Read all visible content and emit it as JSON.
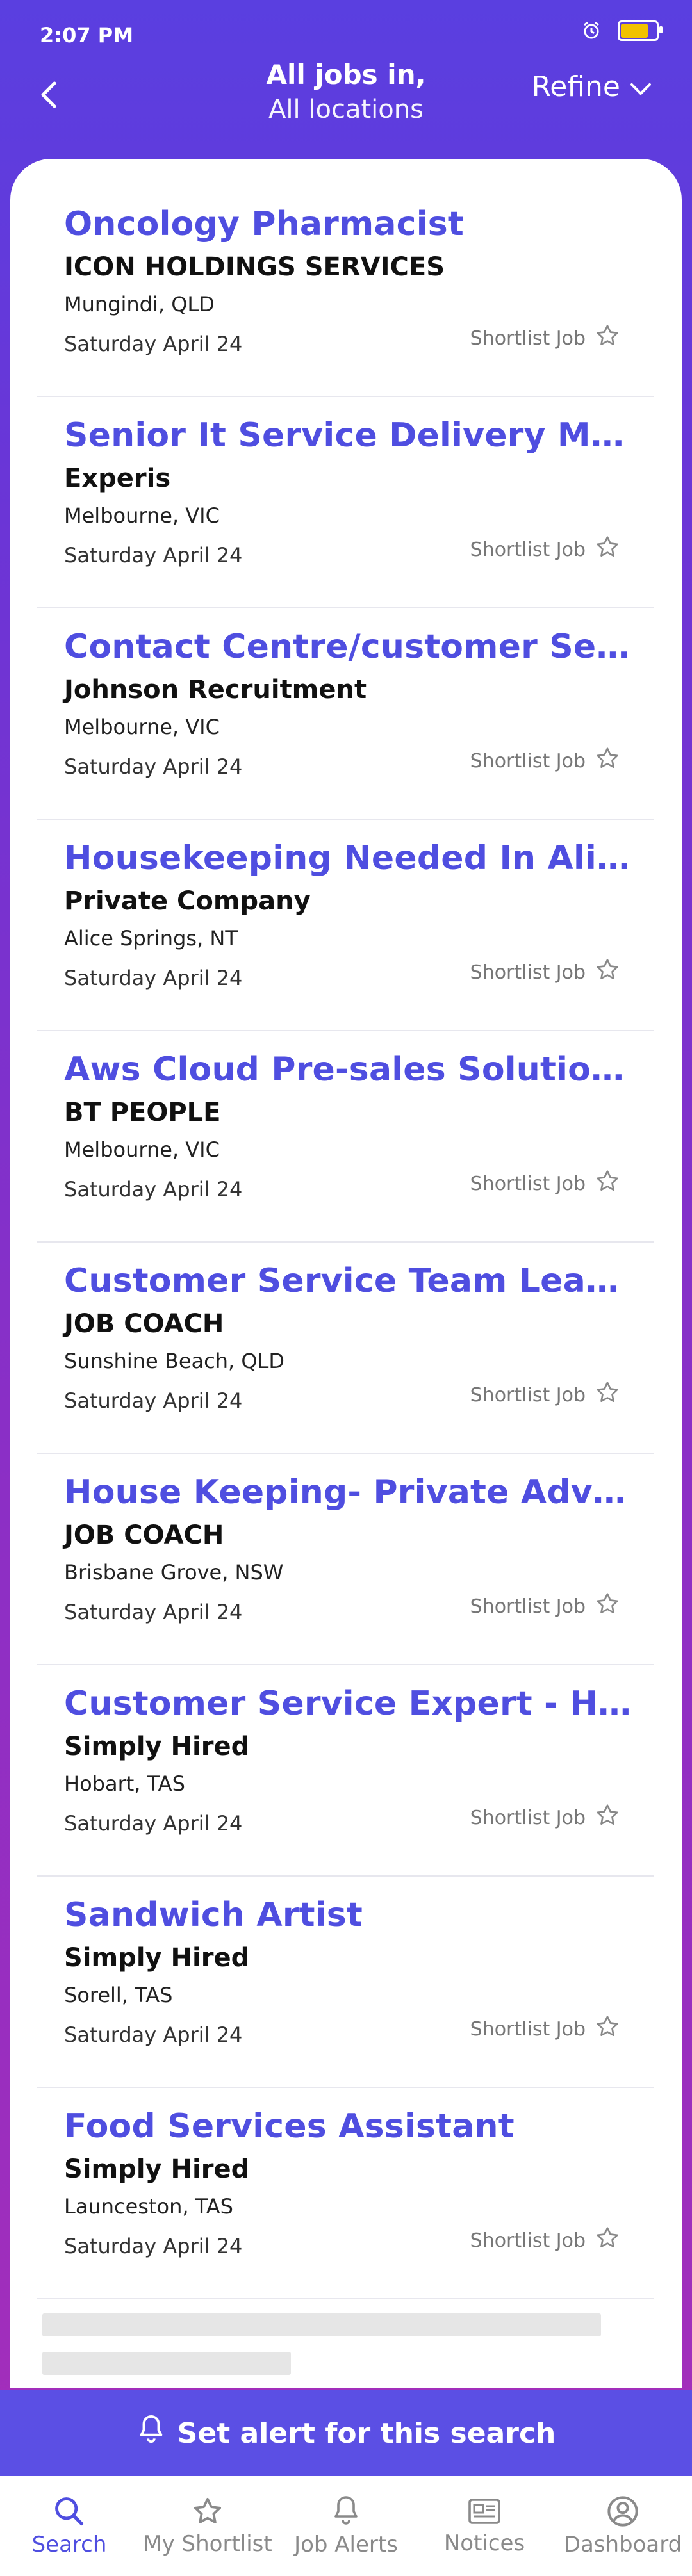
{
  "status_bar": {
    "time": "2:07 PM",
    "battery_level_percent": 80
  },
  "header": {
    "title_line1": "All jobs in,",
    "title_line2": "All locations",
    "refine_label": "Refine"
  },
  "jobs": [
    {
      "title": "Oncology Pharmacist",
      "company": "ICON HOLDINGS SERVICES",
      "location": "Mungindi, QLD",
      "date": "Saturday April 24",
      "shortlist_label": "Shortlist Job"
    },
    {
      "title": "Senior It Service Delivery Manager",
      "company": "Experis",
      "location": "Melbourne, VIC",
      "date": "Saturday April 24",
      "shortlist_label": "Shortlist Job"
    },
    {
      "title": "Contact Centre/customer Service",
      "company": "Johnson Recruitment",
      "location": "Melbourne, VIC",
      "date": "Saturday April 24",
      "shortlist_label": "Shortlist Job"
    },
    {
      "title": "Housekeeping Needed In Alice Springs",
      "company": "Private Company",
      "location": "Alice Springs, NT",
      "date": "Saturday April 24",
      "shortlist_label": "Shortlist Job"
    },
    {
      "title": "Aws Cloud Pre-sales Solutions Architect",
      "company": "BT PEOPLE",
      "location": "Melbourne, VIC",
      "date": "Saturday April 24",
      "shortlist_label": "Shortlist Job"
    },
    {
      "title": "Customer Service Team Leader",
      "company": "JOB COACH",
      "location": "Sunshine Beach, QLD",
      "date": "Saturday April 24",
      "shortlist_label": "Shortlist Job"
    },
    {
      "title": "House Keeping- Private Advertiser",
      "company": "JOB COACH",
      "location": "Brisbane Grove, NSW",
      "date": "Saturday April 24",
      "shortlist_label": "Shortlist Job"
    },
    {
      "title": "Customer Service Expert - Hobart",
      "company": "Simply Hired",
      "location": "Hobart, TAS",
      "date": "Saturday April 24",
      "shortlist_label": "Shortlist Job"
    },
    {
      "title": "Sandwich Artist",
      "company": "Simply Hired",
      "location": "Sorell, TAS",
      "date": "Saturday April 24",
      "shortlist_label": "Shortlist Job"
    },
    {
      "title": "Food Services Assistant",
      "company": "Simply Hired",
      "location": "Launceston, TAS",
      "date": "Saturday April 24",
      "shortlist_label": "Shortlist Job"
    }
  ],
  "alert": {
    "label": "Set alert for this search"
  },
  "nav": {
    "search": "Search",
    "shortlist": "My Shortlist",
    "job_alerts": "Job Alerts",
    "notices": "Notices",
    "dashboard": "Dashboard"
  },
  "colors": {
    "accent": "#4f4ee0",
    "alert_bar": "#5b4fe4",
    "battery": "#f2c200"
  },
  "icons": [
    "back-icon",
    "chevron-down-icon",
    "star-icon",
    "bell-icon",
    "search-icon",
    "newspaper-icon",
    "user-circle-icon",
    "alarm-icon",
    "battery-icon"
  ]
}
